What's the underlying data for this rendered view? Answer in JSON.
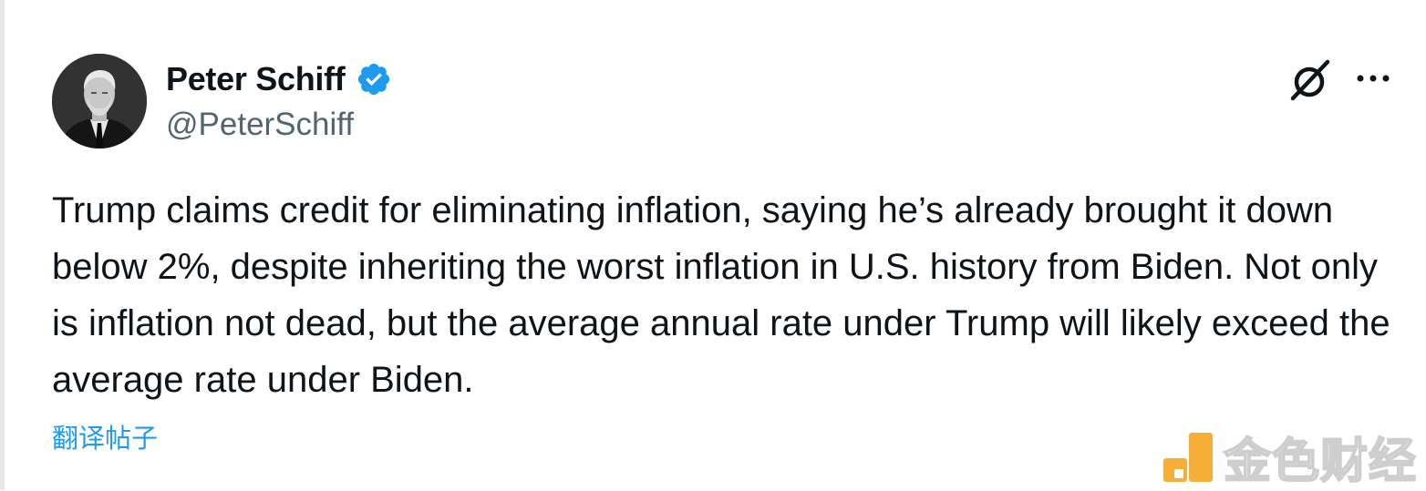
{
  "tweet": {
    "author": {
      "name": "Peter Schiff",
      "handle": "@PeterSchiff",
      "verified": true
    },
    "body": "Trump claims credit for eliminating inflation, saying he’s already brought it down below 2%, despite inheriting the worst inflation in U.S. history from Biden. Not only is inflation not dead, but the average annual rate under Trump will likely exceed the average rate under Biden.",
    "translate_label": "翻译帖子"
  },
  "icons": {
    "verified": "verified-badge-icon",
    "grok": "grok-icon",
    "more": "more-options-icon",
    "watermark_logo": "jinse-logo-icon"
  },
  "watermark": {
    "text": "金色财经"
  },
  "colors": {
    "text_primary": "#0f1419",
    "text_secondary": "#536471",
    "link_blue": "#1d9bf0",
    "verified_blue": "#1d9bf0",
    "watermark_orange": "#f5a623"
  }
}
